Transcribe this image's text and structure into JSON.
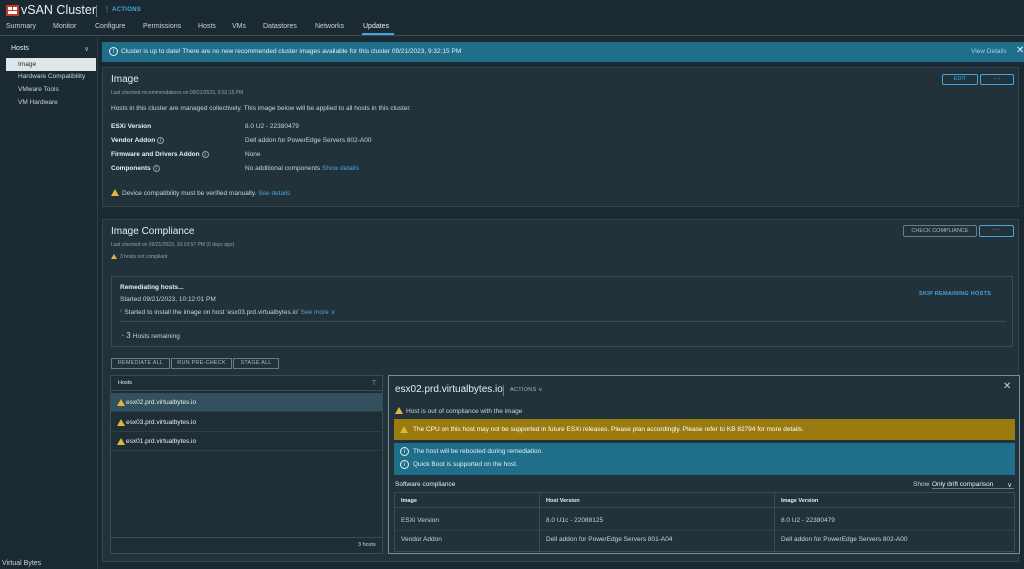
{
  "header": {
    "title": "vSAN Cluster",
    "actions": "ACTIONS"
  },
  "tabs": [
    "Summary",
    "Monitor",
    "Configure",
    "Permissions",
    "Hosts",
    "VMs",
    "Datastores",
    "Networks",
    "Updates"
  ],
  "sidebar": {
    "group": "Hosts",
    "items": [
      "Image",
      "Hardware Compatibility",
      "VMware Tools",
      "VM Hardware"
    ]
  },
  "banner": {
    "text": "Cluster is up to date! There are no new recommended cluster images available for this cluster 09/21/2023, 9:32:15 PM",
    "link": "View Details"
  },
  "image_card": {
    "title": "Image",
    "last_checked": "Last checked recommendations on 09/21/2023, 9:32:15 PM",
    "edit": "EDIT",
    "desc": "Hosts in this cluster are managed collectively. This image below will be applied to all hosts in this cluster.",
    "rows": [
      {
        "label": "ESXi Version",
        "value": "8.0 U2 - 22380479"
      },
      {
        "label": "Vendor Addon",
        "value": "Dell addon for PowerEdge Servers 802-A00"
      },
      {
        "label": "Firmware and Drivers Addon",
        "value": "None"
      },
      {
        "label": "Components",
        "value": "No additional components"
      }
    ],
    "show_details": "Show details",
    "warning": "Device compatibility must be verified manually.",
    "see_details": "See details"
  },
  "compliance": {
    "title": "Image Compliance",
    "last_checked": "Last checked on 09/21/2023, 10:10:57 PM (0 days ago)",
    "not_compliant": "3 hosts not compliant",
    "check_btn": "CHECK COMPLIANCE",
    "remediating": {
      "title": "Remediating hosts...",
      "started": "Started 09/21/2023, 10:12:01 PM",
      "task": "Started to install the image on host 'esx03.prd.virtualbytes.io'",
      "see_more": "See more",
      "remaining_count": "3",
      "remaining_label": "Hosts remaining",
      "skip": "SKIP REMAINING HOSTS"
    },
    "buttons": [
      "REMEDIATE ALL",
      "RUN PRE-CHECK",
      "STAGE ALL"
    ],
    "hosts_header": "Hosts",
    "hosts": [
      "esx02.prd.virtualbytes.io",
      "esx03.prd.virtualbytes.io",
      "esx01.prd.virtualbytes.io"
    ],
    "hosts_count": "3 hosts"
  },
  "detail": {
    "host": "esx02.prd.virtualbytes.io",
    "actions": "ACTIONS",
    "status": "Host is out of compliance with the image",
    "gold_warning": "The CPU on this host may not be supported in future ESXi releases. Please plan accordingly. Please refer to KB 82794 for more details.",
    "info1": "The host will be rebooted during remediation.",
    "info2": "Quick Boot is supported on the host.",
    "software_title": "Software compliance",
    "show_label": "Show",
    "show_value": "Only drift comparison",
    "table": {
      "headers": [
        "Image",
        "Host Version",
        "Image Version"
      ],
      "rows": [
        [
          "ESXi Version",
          "8.0 U1c - 22088125",
          "8.0 U2 - 22380479"
        ],
        [
          "Vendor Addon",
          "Dell addon for PowerEdge Servers 801-A04",
          "Dell addon for PowerEdge Servers 802-A00"
        ]
      ]
    }
  },
  "watermark": "Virtual Bytes",
  "colors": {
    "accent": "#4aa3df",
    "banner": "#1f6f8b",
    "warning": "#9b7a10"
  }
}
